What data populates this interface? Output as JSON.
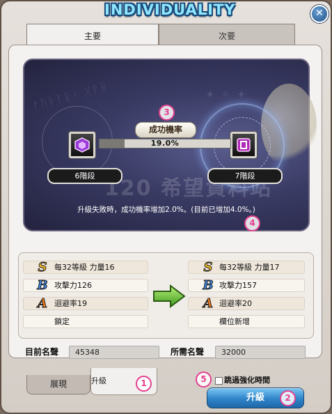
{
  "window": {
    "title": "INDIVIDUALITY",
    "close_glyph": "✕"
  },
  "tabs": {
    "main": "主要",
    "sub": "次要"
  },
  "enhance": {
    "rate_label": "成功機率",
    "rate_value": "19.0%",
    "rate_fraction": 0.19,
    "current_stage": "6階段",
    "next_stage": "7階段",
    "info": "升級失敗時，成功機率增加2.0%。(目前已增加4.0%。)",
    "watermark": "120 希望資料站"
  },
  "markers": {
    "m1": "1",
    "m2": "2",
    "m3": "3",
    "m4": "4",
    "m5": "5"
  },
  "stats": {
    "current": [
      {
        "grade": "S",
        "text": "每32等級 力量16"
      },
      {
        "grade": "B",
        "text": "攻擊力126"
      },
      {
        "grade": "A",
        "text": "迴避率19"
      },
      {
        "grade": "",
        "text": "鎖定"
      }
    ],
    "next": [
      {
        "grade": "S",
        "text": "每32等級 力量17"
      },
      {
        "grade": "B",
        "text": "攻擊力157"
      },
      {
        "grade": "A",
        "text": "迴避率20"
      },
      {
        "grade": "",
        "text": "欄位新增"
      }
    ]
  },
  "fame": {
    "current_label": "目前名聲",
    "current_value": "45348",
    "required_label": "所需名聲",
    "required_value": "32000"
  },
  "bottom_tabs": {
    "show": "展現",
    "upgrade": "升級"
  },
  "skip": {
    "label": "跳過強化時間",
    "checked": false
  },
  "upgrade_button": "升級",
  "colors": {
    "grade_S": "#f3b92a",
    "grade_B": "#3e86e0",
    "grade_A": "#f07a1e",
    "accent": "#e3418f"
  }
}
